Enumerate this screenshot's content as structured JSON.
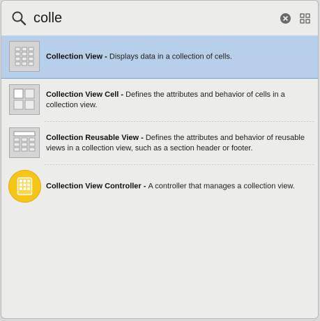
{
  "search": {
    "value": "colle"
  },
  "results": [
    {
      "title": "Collection View",
      "separator": " - ",
      "description": "Displays data in a collection of cells.",
      "icon": "collection-view-icon",
      "selected": true
    },
    {
      "title": "Collection View Cell",
      "separator": " - ",
      "description": "Defines the attributes and behavior of cells in a collection view.",
      "icon": "collection-view-cell-icon",
      "selected": false
    },
    {
      "title": "Collection Reusable View",
      "separator": " - ",
      "description": "Defines the attributes and behavior of reusable views in a collection view, such as a section header or footer.",
      "icon": "collection-reusable-view-icon",
      "selected": false
    },
    {
      "title": "Collection View Controller",
      "separator": " - ",
      "description": "A controller that manages a collection view.",
      "icon": "collection-view-controller-icon",
      "selected": false
    }
  ],
  "colors": {
    "selection": "#b8cfe9",
    "controller_icon": "#f6c51a"
  }
}
